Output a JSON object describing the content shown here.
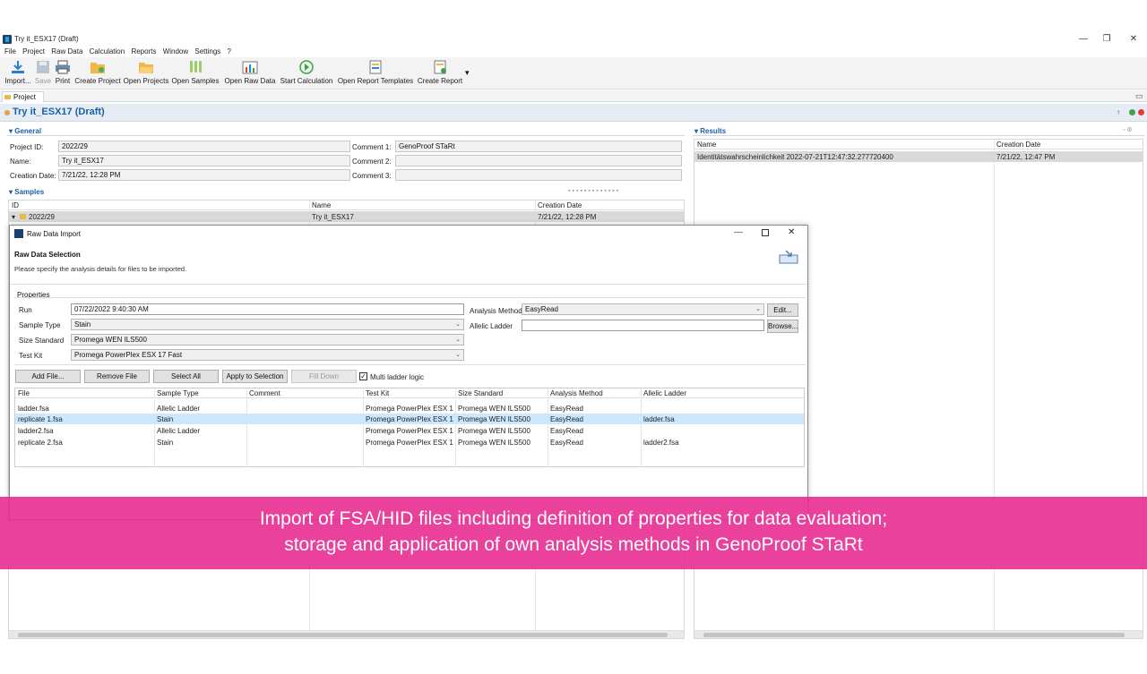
{
  "window": {
    "title": "Try it_ESX17 (Draft)",
    "min": "—",
    "max": "❐",
    "close": "✕"
  },
  "menu": [
    "File",
    "Project",
    "Raw Data",
    "Calculation",
    "Reports",
    "Window",
    "Settings",
    "?"
  ],
  "toolbar": {
    "import": "Import...",
    "save": "Save",
    "print": "Print",
    "create_project": "Create Project",
    "open_projects": "Open Projects",
    "open_samples": "Open Samples",
    "open_raw_data": "Open Raw Data",
    "start_calculation": "Start Calculation",
    "open_report_templates": "Open Report Templates",
    "create_report": "Create Report",
    "dropdown": "▾"
  },
  "project_tab": "Project",
  "project_title": "Try it_ESX17 (Draft)",
  "general": {
    "title": "General",
    "project_id_label": "Project ID:",
    "project_id": "2022/29",
    "name_label": "Name:",
    "name": "Try it_ESX17",
    "creation_date_label": "Creation Date:",
    "creation_date": "7/21/22, 12:28 PM",
    "comment1_label": "Comment 1:",
    "comment1": "GenoProof STaRt",
    "comment2_label": "Comment 2:",
    "comment2": "",
    "comment3_label": "Comment 3:",
    "comment3": ""
  },
  "samples": {
    "title": "Samples",
    "columns": [
      "ID",
      "Name",
      "Creation Date"
    ],
    "row": {
      "id": "2022/29",
      "name": "Try it_ESX17",
      "date": "7/21/22, 12:28 PM"
    }
  },
  "results": {
    "title": "Results",
    "columns": [
      "Name",
      "Creation Date"
    ],
    "row": {
      "name": "Identitätswahrscheinlichkeit 2022-07-21T12:47:32.277720400",
      "date": "7/21/22, 12:47 PM"
    }
  },
  "dialog": {
    "title": "Raw Data Import",
    "heading": "Raw Data Selection",
    "subheading": "Please specify the analysis details for files to be imported.",
    "properties_label": "Properties",
    "run_label": "Run",
    "run_value": "07/22/2022 9:40:30 AM",
    "sample_type_label": "Sample Type",
    "sample_type_value": "Stain",
    "size_standard_label": "Size Standard",
    "size_standard_value": "Promega WEN ILS500",
    "test_kit_label": "Test Kit",
    "test_kit_value": "Promega PowerPlex ESX 17 Fast",
    "analysis_method_label": "Analysis Method",
    "analysis_method_value": "EasyRead",
    "allelic_ladder_label": "Allelic Ladder",
    "allelic_ladder_value": "",
    "edit_button": "Edit...",
    "browse_button": "Browse...",
    "add_file": "Add File...",
    "remove_file": "Remove File",
    "select_all": "Select All",
    "apply_to_selection": "Apply to Selection",
    "fill_down": "Fill Down",
    "multi_ladder": "Multi ladder logic",
    "columns": [
      "File",
      "Sample Type",
      "Comment",
      "Test Kit",
      "Size Standard",
      "Analysis Method",
      "Allelic Ladder"
    ],
    "rows": [
      {
        "file": "ladder.fsa",
        "sample_type": "Allelic Ladder",
        "comment": "",
        "test_kit": "Promega PowerPlex ESX 1...",
        "size_standard": "Promega WEN ILS500",
        "method": "EasyRead",
        "ladder": ""
      },
      {
        "file": "replicate 1.fsa",
        "sample_type": "Stain",
        "comment": "",
        "test_kit": "Promega PowerPlex ESX 1...",
        "size_standard": "Promega WEN ILS500",
        "method": "EasyRead",
        "ladder": "ladder.fsa"
      },
      {
        "file": "ladder2.fsa",
        "sample_type": "Allelic Ladder",
        "comment": "",
        "test_kit": "Promega PowerPlex ESX 1...",
        "size_standard": "Promega WEN ILS500",
        "method": "EasyRead",
        "ladder": ""
      },
      {
        "file": "replicate 2.fsa",
        "sample_type": "Stain",
        "comment": "",
        "test_kit": "Promega PowerPlex ESX 1...",
        "size_standard": "Promega WEN ILS500",
        "method": "EasyRead",
        "ladder": "ladder2.fsa"
      }
    ]
  },
  "banner": {
    "line1": "Import of FSA/HID files including definition of properties for data evaluation;",
    "line2": "storage and application of own analysis methods in GenoProof STaRt"
  },
  "colors": {
    "accent": "#1a5fa8",
    "banner": "#e82c92",
    "selected_row": "#cce8ff"
  }
}
